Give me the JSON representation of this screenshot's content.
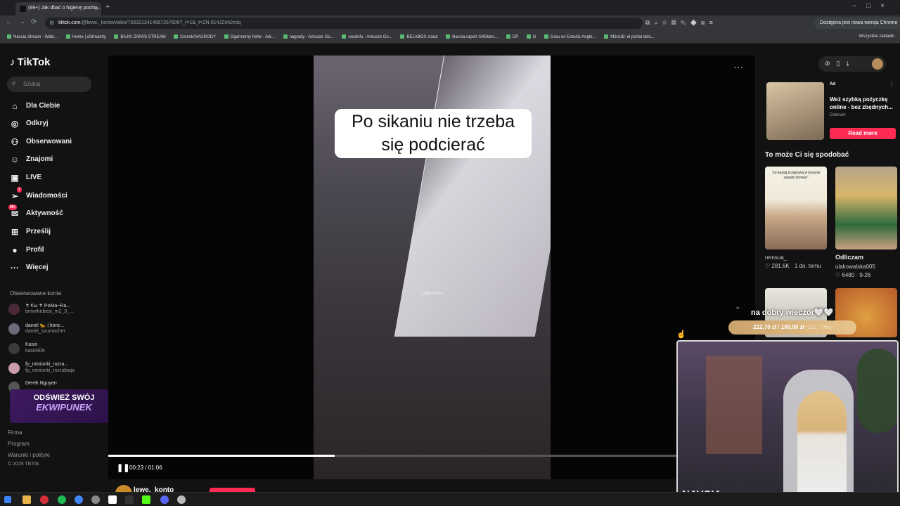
{
  "browser": {
    "tab_title": "(99+) Jak dbać o higienę pocho...",
    "url_domain": "tiktok.com",
    "url_path": "/@lewe._konto/video/7563213414567267606?_r=1&_t=ZN-914JZnh2mlq",
    "update_label": "Dostępna jest nowa wersja Chrome",
    "bookmarks": [
      "Navcia Stream - Watc...",
      "Home | eStreamly",
      "BAJKI ZAPAS STREAM",
      "Cennik/NAGRODY",
      "Ogarniemy hehe - Ark...",
      "nagrody - Arkusze Go...",
      "uwufufu - Arkusze Go...",
      "BELABOX cloud",
      "Navcia raport G4Skins...",
      "DP",
      "D",
      "Grau en Estudis Angle...",
      "MönUB: el portal dels..."
    ],
    "bookmarks_all": "Wszystkie zakładki"
  },
  "sidebar": {
    "logo": "TikTok",
    "search_placeholder": "Szukaj",
    "nav": [
      {
        "label": "Dla Ciebie",
        "icon": "home-icon"
      },
      {
        "label": "Odkryj",
        "icon": "compass-icon"
      },
      {
        "label": "Obserwowani",
        "icon": "following-icon"
      },
      {
        "label": "Znajomi",
        "icon": "friends-icon"
      },
      {
        "label": "LIVE",
        "icon": "live-icon"
      },
      {
        "label": "Wiadomości",
        "icon": "messages-icon",
        "badge": "7"
      },
      {
        "label": "Aktywność",
        "icon": "activity-icon",
        "badge": "99+"
      },
      {
        "label": "Prześlij",
        "icon": "upload-icon"
      },
      {
        "label": "Profil",
        "icon": "profile-icon"
      },
      {
        "label": "Więcej",
        "icon": "more-icon"
      }
    ],
    "followed_title": "Obserwowane konta",
    "accounts": [
      {
        "name": "✝ €ω ✝ PoMa~Ra...",
        "handle": "bmwthebest_m2_3_..."
      },
      {
        "name": "daniel 🐆 | konc...",
        "handle": "daniel_szumacher"
      },
      {
        "name": "Kasix",
        "handle": "kasix909"
      },
      {
        "name": "fp_minionki_rozra...",
        "handle": "fp_minionki_rozrabiaja"
      },
      {
        "name": "Derek Nguyen",
        "handle": ""
      }
    ],
    "overlay_banner": {
      "line1": "ODŚWIEŻ SWÓJ",
      "line2": "EKWIPUNEK"
    },
    "footer": [
      "Firma",
      "Program",
      "Warunki i polityki",
      "© 2025 TikTok"
    ]
  },
  "video": {
    "caption": "Po sikaniu nie trzeba się podcierać",
    "watermark": "Lewe konto",
    "time": "00:23 / 01:06",
    "progress": 0.35,
    "author": "lewe._konto"
  },
  "right": {
    "ad_tag": "Ad",
    "ad_title": "Weź szybką pożyczkę online - bez zbędnych...",
    "ad_brand": "Colorum",
    "ad_button": "Read more",
    "recommend_title": "To może Ci się spodobać",
    "thumb1_text": "\"za każdą przegraną w kosynie zasadź drzewo\"",
    "rec1": {
      "user": "remsua_",
      "likes": "281.6K",
      "time": "1 dn. temu"
    },
    "rec2": {
      "title": "Odliczam",
      "user": "ulakowalska005",
      "likes": "6480",
      "time": "9-26"
    }
  },
  "stream": {
    "chat_text": "na dobry wieczór🤍🤍",
    "donation": "222,70 zł  /  100,00 zł",
    "donation_pct": "(222,70%)",
    "cam_name": "NAVCIA"
  }
}
